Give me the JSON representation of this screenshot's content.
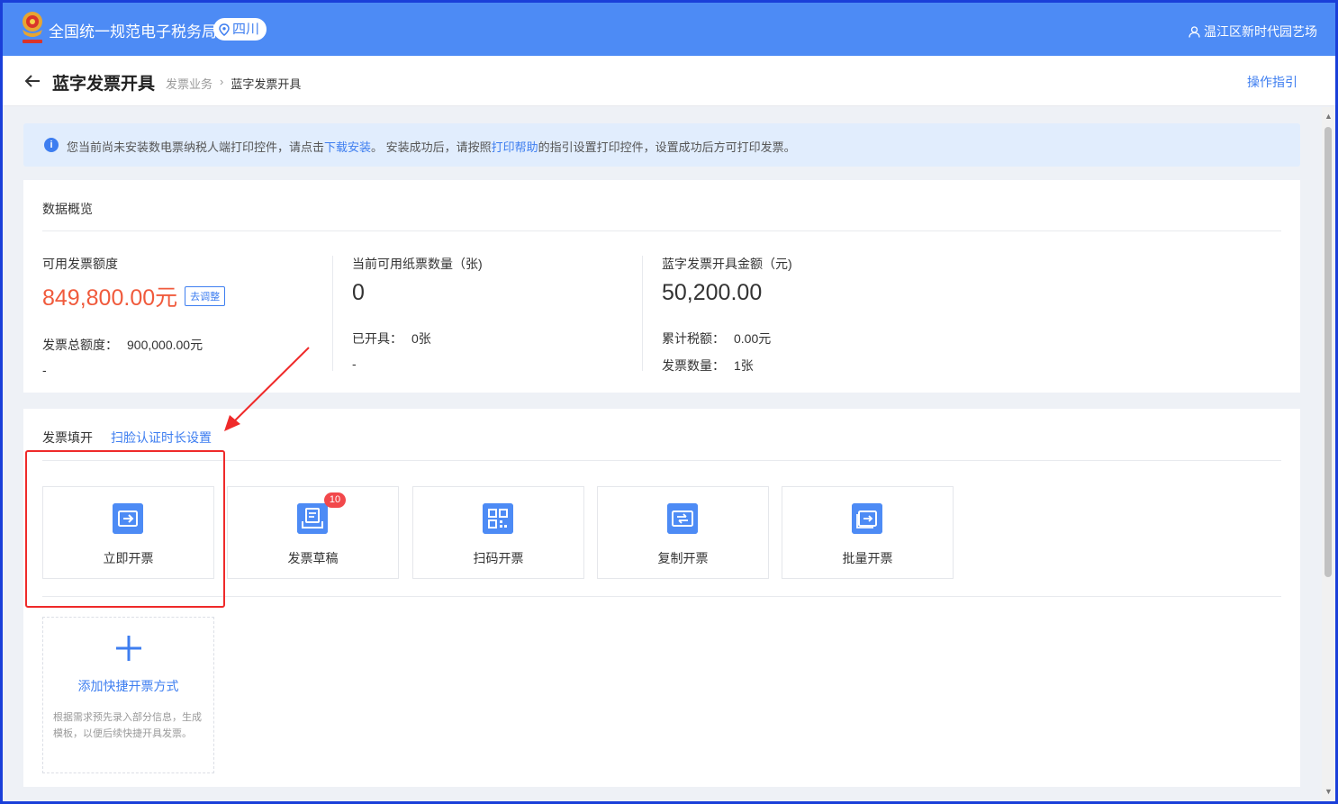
{
  "header": {
    "app_title": "全国统一规范电子税务局",
    "region": "四川",
    "user_name": "温江区新时代园艺场",
    "colors": {
      "brand": "#4d8bf5",
      "accent": "#3e7ef0",
      "highlight_red": "#f05a3c"
    }
  },
  "titlebar": {
    "page_title": "蓝字发票开具",
    "breadcrumb": [
      "发票业务",
      "蓝字发票开具"
    ],
    "guide_link": "操作指引"
  },
  "notice": {
    "prefix": "您当前尚未安装数电票纳税人端打印控件，请点击",
    "download_link": "下载安装",
    "middle": "。 安装成功后，请按照",
    "help_link": "打印帮助",
    "suffix": "的指引设置打印控件，设置成功后方可打印发票。"
  },
  "overview": {
    "title": "数据概览",
    "columns": [
      {
        "label": "可用发票额度",
        "value": "849,800.00元",
        "action": "去调整",
        "rows": [
          {
            "label": "发票总额度：",
            "value": "900,000.00元"
          },
          {
            "label": "-",
            "value": ""
          }
        ]
      },
      {
        "label": "当前可用纸票数量（张)",
        "value": "0",
        "rows": [
          {
            "label": "已开具：",
            "value": "0张"
          },
          {
            "label": "-",
            "value": ""
          }
        ]
      },
      {
        "label": "蓝字发票开具金额（元)",
        "value": "50,200.00",
        "rows": [
          {
            "label": "累计税额：",
            "value": "0.00元"
          },
          {
            "label": "发票数量：",
            "value": "1张"
          }
        ]
      }
    ]
  },
  "fill": {
    "title": "发票填开",
    "scan_setting_link": "扫脸认证时长设置",
    "tiles": [
      {
        "label": "立即开票",
        "icon": "invoice-issue-icon"
      },
      {
        "label": "发票草稿",
        "icon": "invoice-draft-icon",
        "badge": "10"
      },
      {
        "label": "扫码开票",
        "icon": "qr-code-icon"
      },
      {
        "label": "复制开票",
        "icon": "copy-invoice-icon"
      },
      {
        "label": "批量开票",
        "icon": "batch-invoice-icon"
      }
    ],
    "add_tile": {
      "label": "添加快捷开票方式",
      "description": "根据需求预先录入部分信息，生成模板，以便后续快捷开具发票。"
    }
  }
}
